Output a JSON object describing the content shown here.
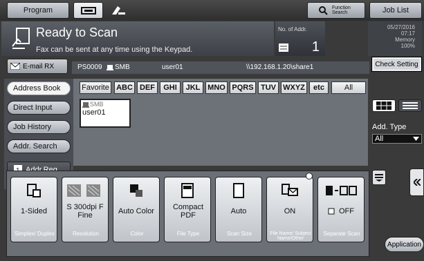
{
  "header": {
    "program_label": "Program",
    "function_search_label": "Function Search",
    "job_list_label": "Job List"
  },
  "status": {
    "title": "Ready to Scan",
    "message": "Fax can be sent at any time using the Keypad.",
    "addr_count_label": "No. of Addr.",
    "addr_count_value": "1",
    "date": "05/27/2016",
    "time": "07:17",
    "memory_label": "Memory",
    "memory_value": "100%"
  },
  "email_rx_label": "E-mail RX",
  "check_setting_label": "Check Setting",
  "destination": {
    "id": "PS0009",
    "type": "SMB",
    "user": "user01",
    "path": "\\\\192.168.1.20\\share1"
  },
  "nav": {
    "address_book": "Address Book",
    "direct_input": "Direct Input",
    "job_history": "Job History",
    "addr_search": "Addr. Search",
    "addr_reg": "Addr.Reg."
  },
  "tabs": [
    "Favorite",
    "ABC",
    "DEF",
    "GHI",
    "JKL",
    "MNO",
    "PQRS",
    "TUV",
    "WXYZ",
    "etc",
    "All"
  ],
  "entry": {
    "type": "SMB",
    "name": "user01"
  },
  "add_type": {
    "label": "Add. Type",
    "value": "All"
  },
  "toolbar": [
    {
      "value": "1-Sided",
      "caption": "Simplex/ Duplex",
      "icon": "simplex-icon"
    },
    {
      "value": "S 300dpi F Fine",
      "caption": "Resolution",
      "icon": "resolution-icon"
    },
    {
      "value": "Auto Color",
      "caption": "Color",
      "icon": "color-icon"
    },
    {
      "value": "Compact PDF",
      "caption": "File Type",
      "icon": "pdf-icon"
    },
    {
      "value": "Auto",
      "caption": "Scan Size",
      "icon": "page-icon"
    },
    {
      "value": "ON",
      "caption": "File Name/ Subject Name/Other",
      "icon": "email-icon"
    },
    {
      "value": "OFF",
      "caption": "Separate Scan",
      "icon": "separate-scan-icon"
    }
  ],
  "application_label": "Application"
}
